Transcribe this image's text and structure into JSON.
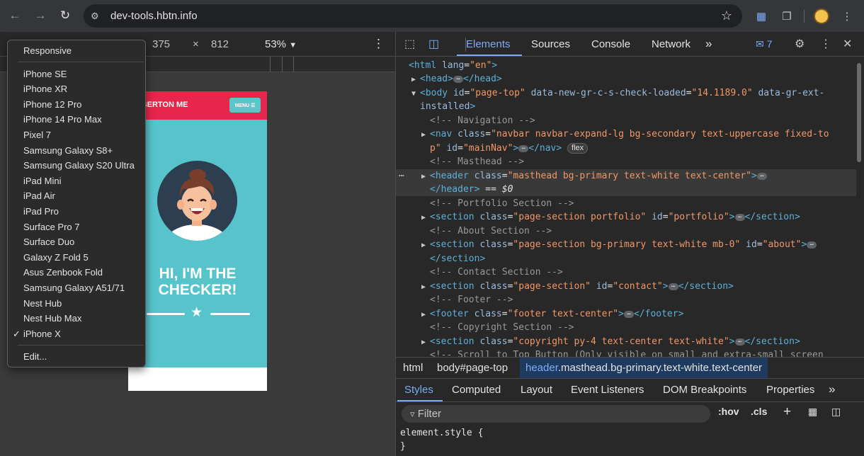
{
  "browser": {
    "url": "dev-tools.hbtn.info"
  },
  "device_toolbar": {
    "width": "375",
    "times": "×",
    "height": "812",
    "zoom": "53%"
  },
  "device_menu": {
    "header": "Responsive",
    "items": [
      "iPhone SE",
      "iPhone XR",
      "iPhone 12 Pro",
      "iPhone 14 Pro Max",
      "Pixel 7",
      "Samsung Galaxy S8+",
      "Samsung Galaxy S20 Ultra",
      "iPad Mini",
      "iPad Air",
      "iPad Pro",
      "Surface Pro 7",
      "Surface Duo",
      "Galaxy Z Fold 5",
      "Asus Zenbook Fold",
      "Samsung Galaxy A51/71",
      "Nest Hub",
      "Nest Hub Max",
      "iPhone X"
    ],
    "selected": "iPhone X",
    "edit": "Edit..."
  },
  "phone_page": {
    "brand": "ALBERTON ME",
    "menu_button": "MENU ☰",
    "headline_1": "HI, I'M THE",
    "headline_2": "CHECKER!",
    "colors": {
      "navbar": "#e8254a",
      "masthead": "#57c4cb"
    }
  },
  "devtools": {
    "tabs": [
      "Elements",
      "Sources",
      "Console",
      "Network"
    ],
    "active_tab": "Elements",
    "more_tabs": "»",
    "message_count": "7",
    "tree": {
      "l0_tag": "<html",
      "l0_attr": "lang",
      "l0_val": "\"en\"",
      "l1": "<head>",
      "l1_close": "</head>",
      "l2_tag": "<body",
      "l2_a1": "id",
      "l2_v1": "\"page-top\"",
      "l2_a2": "data-new-gr-c-s-check-loaded",
      "l2_v2": "\"14.1189.0\"",
      "l2_a3": "data-gr-ext-",
      "l2b_a3": "installed",
      "l2b_close": ">",
      "c_nav": "<!-- Navigation -->",
      "nav_tag": "<nav",
      "nav_a1": "class",
      "nav_v1": "\"navbar navbar-expand-lg bg-secondary text-uppercase fixed-to",
      "nav2_v1": "p\"",
      "nav2_a2": "id",
      "nav2_v2": "\"mainNav\"",
      "nav2_close": "</nav>",
      "nav2_badge": "flex",
      "c_masthead": "<!-- Masthead -->",
      "hdr_tag": "<header",
      "hdr_a1": "class",
      "hdr_v1": "\"masthead bg-primary text-white text-center\"",
      "hdr2_close": "</header>",
      "hdr2_eq": "==",
      "hdr2_var": "$0",
      "c_portfolio": "<!-- Portfolio Section -->",
      "port_tag": "<section",
      "port_a1": "class",
      "port_v1": "\"page-section portfolio\"",
      "port_a2": "id",
      "port_v2": "\"portfolio\"",
      "port_close": "</section>",
      "c_about": "<!-- About Section -->",
      "about_tag": "<section",
      "about_a1": "class",
      "about_v1": "\"page-section bg-primary text-white mb-0\"",
      "about_a2": "id",
      "about_v2": "\"about\"",
      "about2_close": "</section>",
      "c_contact": "<!-- Contact Section -->",
      "contact_tag": "<section",
      "contact_a1": "class",
      "contact_v1": "\"page-section\"",
      "contact_a2": "id",
      "contact_v2": "\"contact\"",
      "contact_close": "</section>",
      "c_footer": "<!-- Footer -->",
      "footer_tag": "<footer",
      "footer_a1": "class",
      "footer_v1": "\"footer text-center\"",
      "footer_close": "</footer>",
      "c_copyright": "<!-- Copyright Section -->",
      "copy_tag": "<section",
      "copy_a1": "class",
      "copy_v1": "\"copyright py-4 text-center text-white\"",
      "copy_close": "</section>",
      "c_scroll": "<!-- Scroll to Top Button (Only visible on small and extra-small screen"
    },
    "breadcrumbs": {
      "c1": "html",
      "c2": "body#page-top",
      "c3a": "header",
      "c3b": ".masthead.bg-primary.text-white.text-center"
    },
    "style_tabs": [
      "Styles",
      "Computed",
      "Layout",
      "Event Listeners",
      "DOM Breakpoints",
      "Properties"
    ],
    "style_more": "»",
    "filter_placeholder": "Filter",
    "hov": ":hov",
    "cls": ".cls",
    "element_style_1": "element.style {",
    "element_style_2": "}"
  }
}
